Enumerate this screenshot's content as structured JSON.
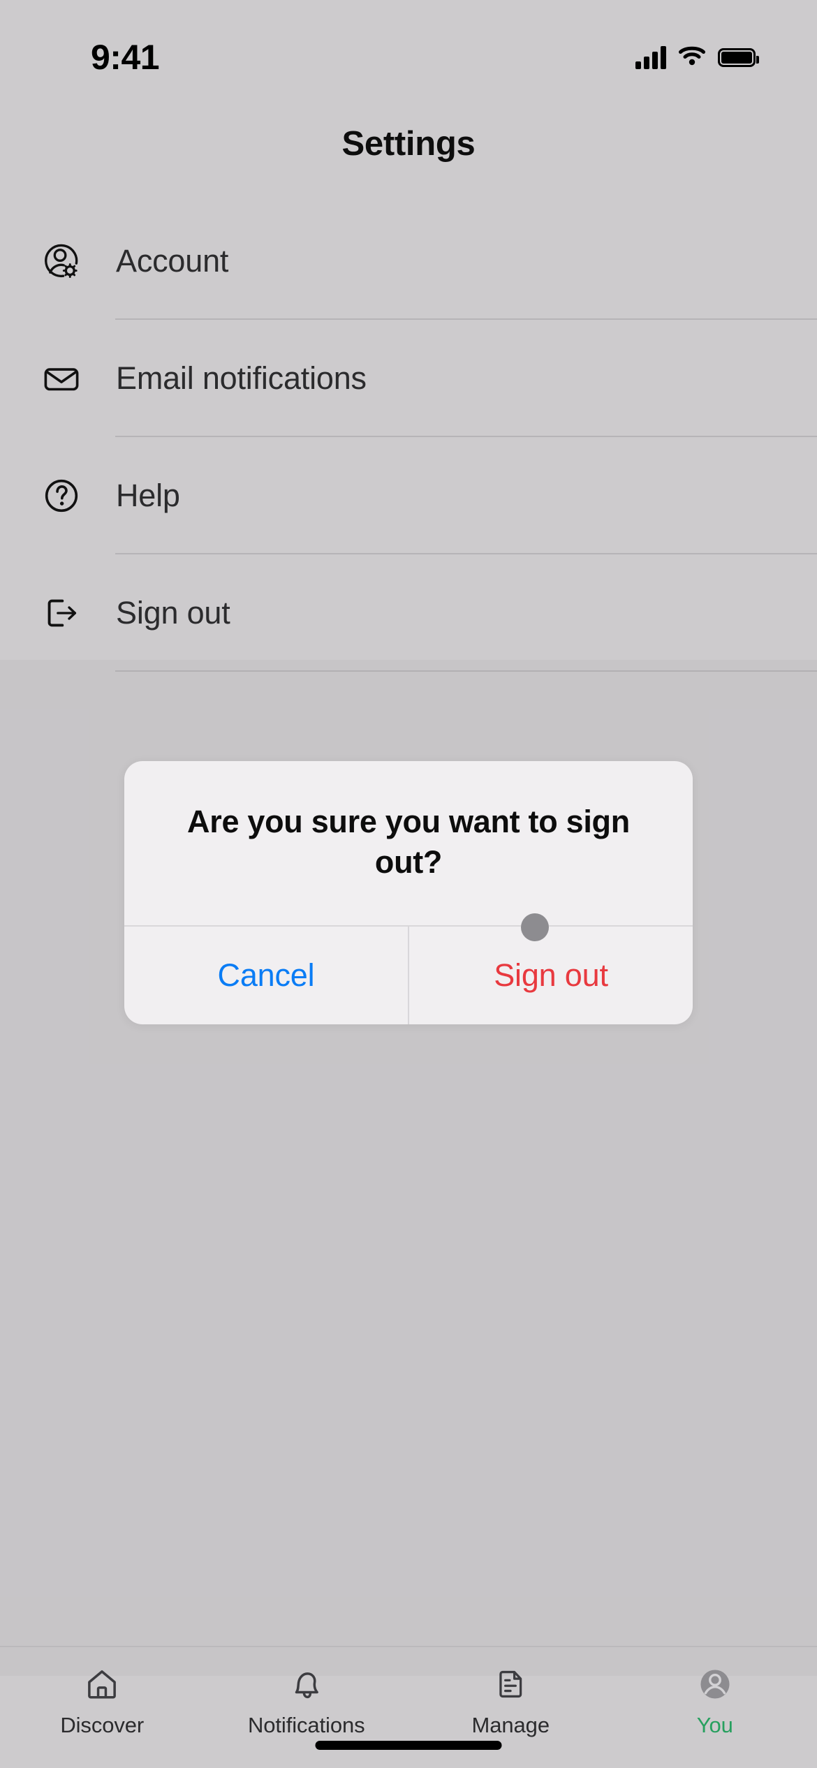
{
  "status_bar": {
    "time": "9:41",
    "cellular_icon": "signal-bars-icon",
    "wifi_icon": "wifi-icon",
    "battery_icon": "battery-icon"
  },
  "header": {
    "title": "Settings"
  },
  "settings": {
    "items": [
      {
        "label": "Account",
        "icon": "account-gear-icon"
      },
      {
        "label": "Email notifications",
        "icon": "envelope-icon"
      },
      {
        "label": "Help",
        "icon": "question-circle-icon"
      },
      {
        "label": "Sign out",
        "icon": "logout-icon"
      }
    ]
  },
  "alert": {
    "message": "Are you sure you want to sign out?",
    "cancel_label": "Cancel",
    "confirm_label": "Sign out",
    "cancel_color": "#0a7cf5",
    "confirm_color": "#e8393f"
  },
  "cursor": {
    "name": "touch-cursor",
    "color": "#8d8c90"
  },
  "tab_bar": {
    "active_color": "#27a05f",
    "items": [
      {
        "label": "Discover",
        "icon": "home-icon",
        "active": false
      },
      {
        "label": "Notifications",
        "icon": "bell-icon",
        "active": false
      },
      {
        "label": "Manage",
        "icon": "document-icon",
        "active": false
      },
      {
        "label": "You",
        "icon": "avatar-icon",
        "active": true
      }
    ]
  }
}
